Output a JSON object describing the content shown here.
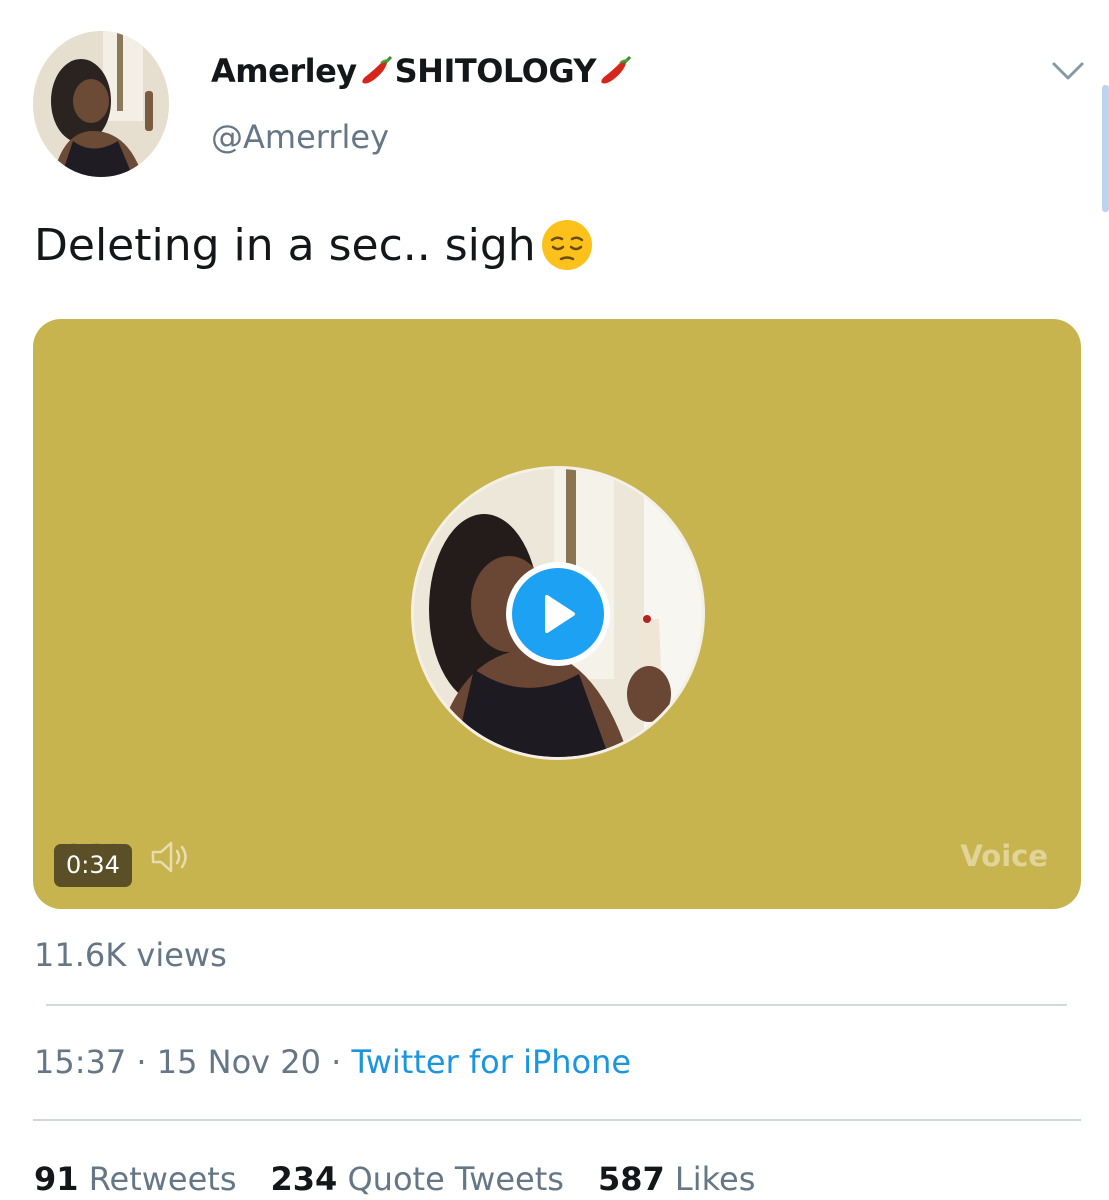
{
  "user": {
    "display_name_part1": "Amerley",
    "display_name_part2": "SHITOLOGY",
    "handle": "@Amerrley",
    "name_emoji": "hot-pepper"
  },
  "tweet": {
    "text": "Deleting in a sec.. sigh",
    "text_emoji": "pensive-face"
  },
  "media": {
    "type": "Voice",
    "label": "Voice",
    "duration": "0:34",
    "background": "#c8b44f",
    "play_color": "#1da1f2"
  },
  "views": "11.6K views",
  "meta": {
    "time": "15:37",
    "separator": "·",
    "date": "15 Nov 20",
    "source": "Twitter for iPhone"
  },
  "stats": [
    {
      "count": "91",
      "label": "Retweets"
    },
    {
      "count": "234",
      "label": "Quote Tweets"
    },
    {
      "count": "587",
      "label": "Likes"
    }
  ],
  "colors": {
    "text_primary": "#14171a",
    "text_secondary": "#657786",
    "link": "#1b95e0"
  }
}
